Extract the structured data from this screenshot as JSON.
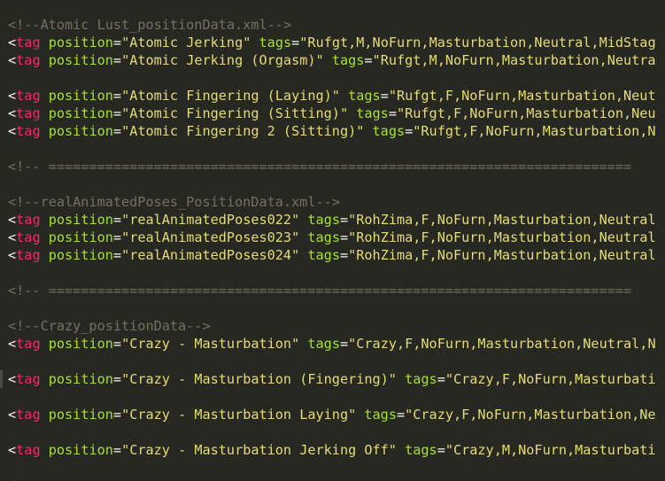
{
  "syntax": {
    "comment": "#75715E",
    "tag": "#F92672",
    "attribute": "#A6E22E",
    "string": "#E6DB74",
    "text": "#F8F8F2",
    "background": "#272822"
  },
  "editor": {
    "comments": {
      "c1": "<!--Atomic Lust_positionData.xml-->",
      "c2": "<!-- ========================================================================",
      "c3": "<!--realAnimatedPoses_PositionData.xml-->",
      "c4": "<!-- ========================================================================",
      "c5": "<!--Crazy_positionData-->"
    },
    "tag_open": "<",
    "tag_name": "tag",
    "attr_position": "position",
    "attr_tags": "tags",
    "equals": "=",
    "lines": [
      {
        "position": "\"Atomic Jerking\"",
        "tags": "\"Rufgt,M,NoFurn,Masturbation,Neutral,MidStag"
      },
      {
        "position": "\"Atomic Jerking (Orgasm)\"",
        "tags": "\"Rufgt,M,NoFurn,Masturbation,Neutra"
      },
      {
        "position": "\"Atomic Fingering (Laying)\"",
        "tags": "\"Rufgt,F,NoFurn,Masturbation,Neut"
      },
      {
        "position": "\"Atomic Fingering (Sitting)\"",
        "tags": "\"Rufgt,F,NoFurn,Masturbation,Neu"
      },
      {
        "position": "\"Atomic Fingering 2 (Sitting)\"",
        "tags": "\"Rufgt,F,NoFurn,Masturbation,N"
      },
      {
        "position": "\"realAnimatedPoses022\"",
        "tags": "\"RohZima,F,NoFurn,Masturbation,Neutral"
      },
      {
        "position": "\"realAnimatedPoses023\"",
        "tags": "\"RohZima,F,NoFurn,Masturbation,Neutral"
      },
      {
        "position": "\"realAnimatedPoses024\"",
        "tags": "\"RohZima,F,NoFurn,Masturbation,Neutral"
      },
      {
        "position": "\"Crazy - Masturbation\"",
        "tags": "\"Crazy,F,NoFurn,Masturbation,Neutral,N"
      },
      {
        "position": "\"Crazy - Masturbation (Fingering)\"",
        "tags": "\"Crazy,F,NoFurn,Masturbati"
      },
      {
        "position": "\"Crazy - Masturbation Laying\"",
        "tags": "\"Crazy,F,NoFurn,Masturbation,Ne"
      },
      {
        "position": "\"Crazy - Masturbation Jerking Off\"",
        "tags": "\"Crazy,M,NoFurn,Masturbati"
      }
    ]
  }
}
